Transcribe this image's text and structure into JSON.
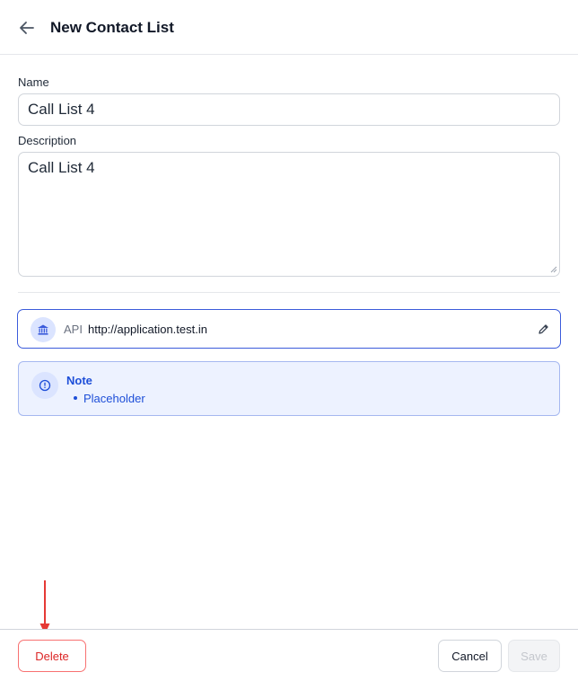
{
  "header": {
    "title": "New Contact List",
    "back_icon": "arrow-left-icon"
  },
  "form": {
    "name_label": "Name",
    "name_value": "Call List 4",
    "description_label": "Description",
    "description_value": "Call List 4"
  },
  "api": {
    "icon": "bank-icon",
    "label": "API",
    "url": "http://application.test.in",
    "edit_icon": "pencil-icon"
  },
  "note": {
    "icon": "info-icon",
    "title": "Note",
    "items": [
      "Placeholder"
    ]
  },
  "footer": {
    "delete_label": "Delete",
    "cancel_label": "Cancel",
    "save_label": "Save"
  },
  "colors": {
    "accent": "#3b5bdb",
    "danger": "#dc2626",
    "note_background": "#edf2ff",
    "annotation_arrow": "#e53935"
  }
}
